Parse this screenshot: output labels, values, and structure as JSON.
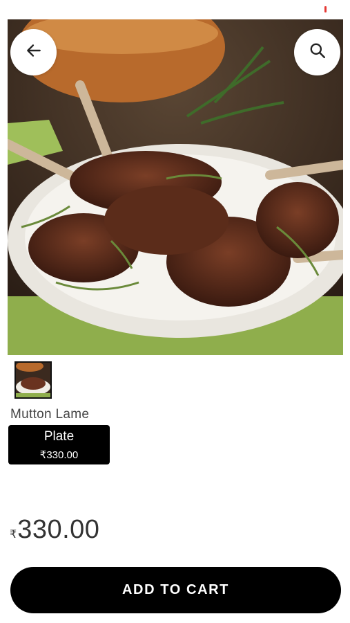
{
  "header": {
    "back_icon": "arrow-left-icon",
    "search_icon": "search-icon"
  },
  "hero": {
    "image": "grilled-lamb-chops-on-plate"
  },
  "product": {
    "name": "Mutton Lame",
    "variants": [
      {
        "label": "Plate",
        "price": "₹330.00",
        "selected": true
      }
    ],
    "price_currency": "₹",
    "price_amount": "330.00"
  },
  "actions": {
    "add_to_cart_label": "ADD TO CART"
  },
  "colors": {
    "primary": "#000000",
    "background": "#ffffff",
    "status_accent": "#e53935"
  }
}
